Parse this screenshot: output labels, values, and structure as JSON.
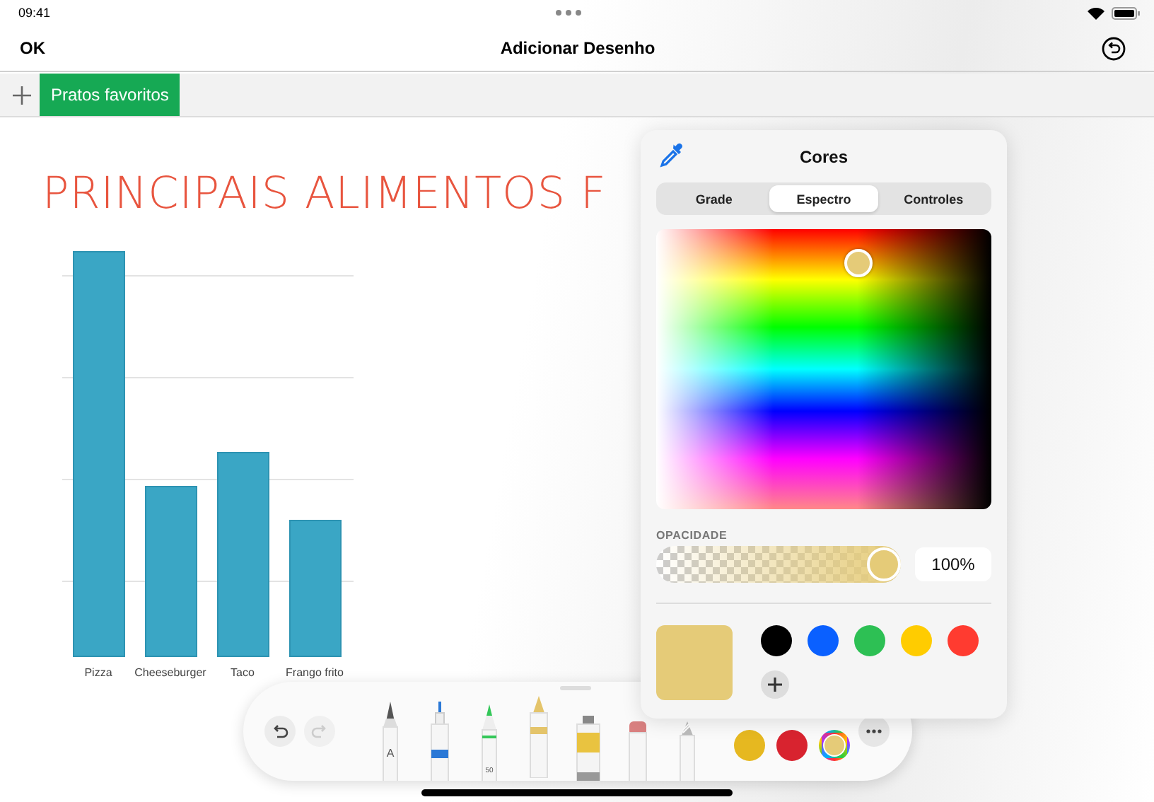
{
  "status_bar": {
    "time": "09:41"
  },
  "nav": {
    "done": "OK",
    "title": "Adicionar Desenho"
  },
  "sheet_tabs": [
    {
      "label": "Pratos favoritos",
      "selected": true
    }
  ],
  "slide": {
    "title": "PRINCIPAIS ALIMENTOS F",
    "chart_labels": [
      "Pizza",
      "Cheeseburger",
      "Taco",
      "Frango frito"
    ]
  },
  "color_popover": {
    "title": "Cores",
    "segments": [
      {
        "label": "Grade",
        "selected": false
      },
      {
        "label": "Espectro",
        "selected": true
      },
      {
        "label": "Controles",
        "selected": false
      }
    ],
    "opacity": {
      "label": "OPACIDADE",
      "level": 1,
      "reading": "100%"
    },
    "swatches": [
      {
        "kind": "current",
        "color": "#e5cb78"
      },
      {
        "color": "#000000"
      },
      {
        "color": "#0a60ff"
      },
      {
        "color": "#2dc054"
      },
      {
        "color": "#ffcc00"
      },
      {
        "color": "#ff3b30"
      }
    ]
  },
  "toolbar": {
    "tools": [
      {
        "kind": "pen",
        "label": "A",
        "selected": false
      },
      {
        "kind": "marker",
        "selected": false
      },
      {
        "kind": "pencil",
        "label": "50",
        "selected": false
      },
      {
        "kind": "crayon",
        "selected": true
      },
      {
        "kind": "paint",
        "selected": false
      },
      {
        "kind": "eraser",
        "selected": false
      },
      {
        "kind": "lasso",
        "selected": false
      }
    ],
    "colors": [
      {
        "color": "#e6b820"
      },
      {
        "color": "#d8232f"
      }
    ]
  }
}
